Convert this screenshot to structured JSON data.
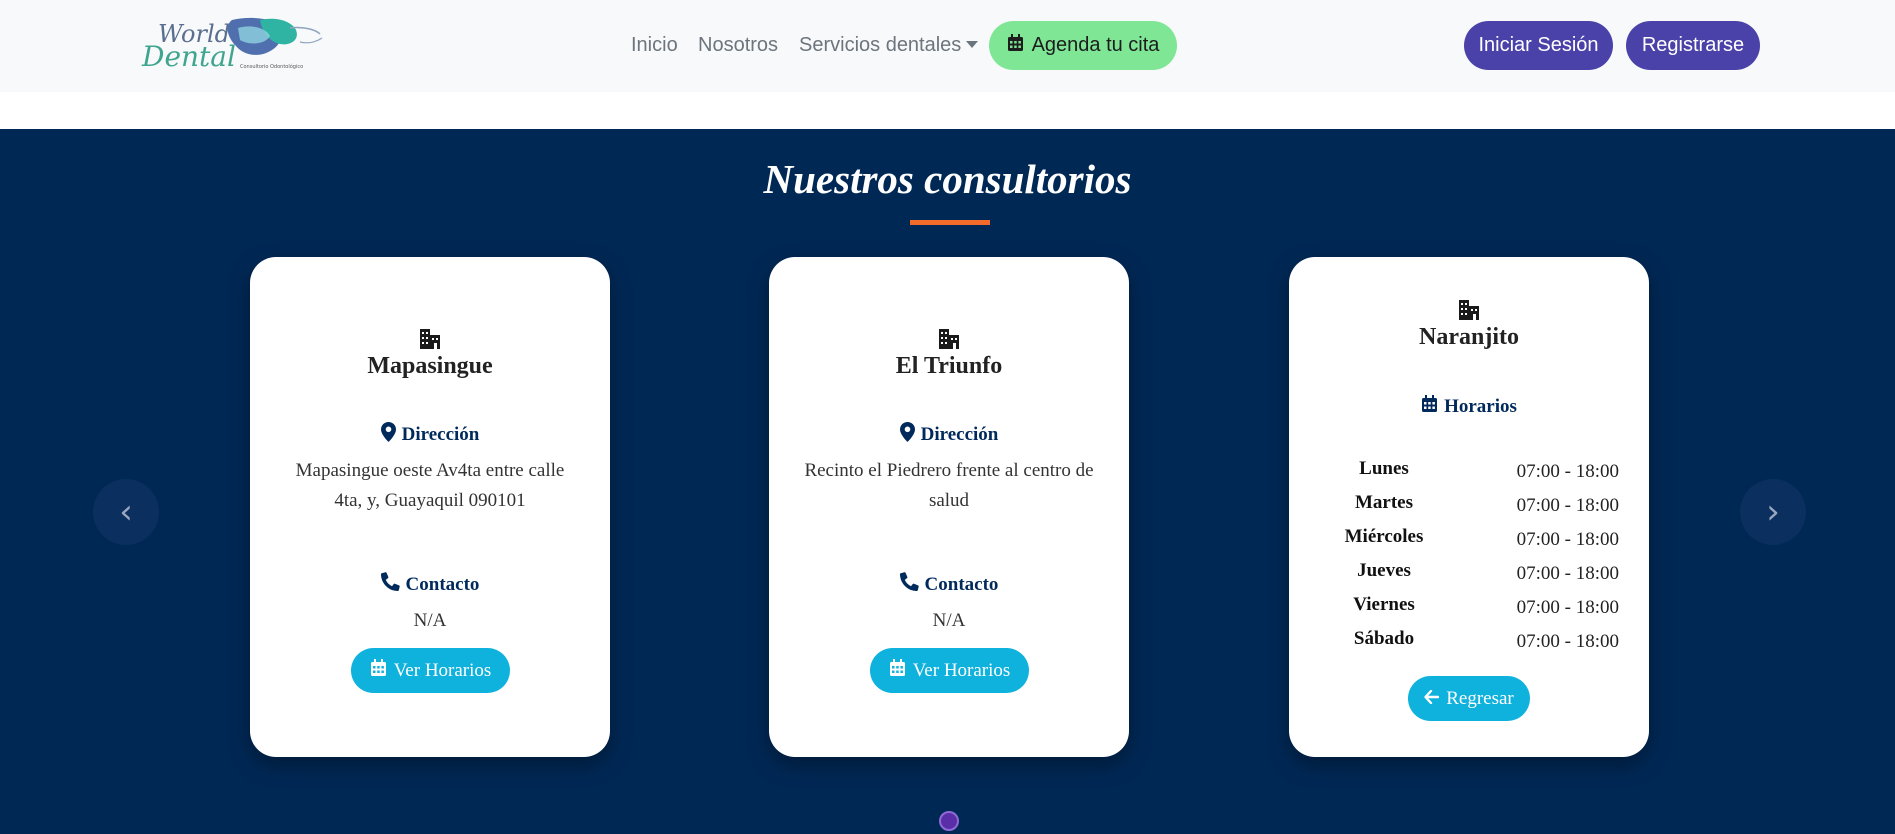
{
  "nav": {
    "logo_line1": "World",
    "logo_line2": "Dental",
    "logo_sub": "Consultorio Odontológico",
    "links": [
      "Inicio",
      "Nosotros",
      "Servicios dentales"
    ],
    "agenda_label": "Agenda tu cita",
    "login_label": "Iniciar Sesión",
    "register_label": "Registrarse"
  },
  "section": {
    "title": "Nuestros consultorios"
  },
  "cards": [
    {
      "name": "Mapasingue",
      "address_heading": "Dirección",
      "address": "Mapasingue oeste Av4ta entre calle 4ta, y, Guayaquil 090101",
      "contact_heading": "Contacto",
      "contact": "N/A",
      "button": "Ver Horarios"
    },
    {
      "name": "El Triunfo",
      "address_heading": "Dirección",
      "address": "Recinto el Piedrero frente al centro de salud",
      "contact_heading": "Contacto",
      "contact": "N/A",
      "button": "Ver Horarios"
    },
    {
      "name": "Naranjito",
      "schedule_heading": "Horarios",
      "schedule": [
        {
          "day": "Lunes",
          "time": "07:00 - 18:00"
        },
        {
          "day": "Martes",
          "time": "07:00 - 18:00"
        },
        {
          "day": "Miércoles",
          "time": "07:00 - 18:00"
        },
        {
          "day": "Jueves",
          "time": "07:00 - 18:00"
        },
        {
          "day": "Viernes",
          "time": "07:00 - 18:00"
        },
        {
          "day": "Sábado",
          "time": "07:00 - 18:00"
        }
      ],
      "button": "Regresar"
    }
  ],
  "carousel": {
    "prev_glyph": "‹",
    "next_glyph": "›"
  },
  "colors": {
    "navy": "#002855",
    "accent_orange": "#f26b2b",
    "cyan_button": "#0fb2dc",
    "purple_button": "#4a42a8",
    "green_button": "#7ee695"
  }
}
